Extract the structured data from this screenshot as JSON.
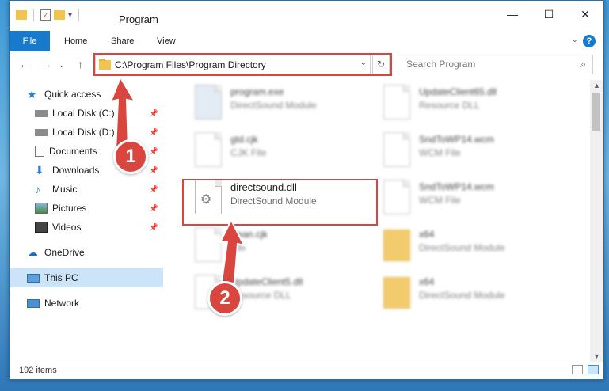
{
  "window": {
    "title": "Program"
  },
  "ribbon": {
    "file": "File",
    "home": "Home",
    "share": "Share",
    "view": "View",
    "help": "?"
  },
  "address": {
    "path": "C:\\Program Files\\Program Directory"
  },
  "search": {
    "placeholder": "Search Program"
  },
  "sidebar": {
    "items": [
      {
        "label": "Quick access",
        "icon": "star-icon"
      },
      {
        "label": "Local Disk (C:)",
        "icon": "drive-icon"
      },
      {
        "label": "Local Disk (D:)",
        "icon": "drive-icon"
      },
      {
        "label": "Documents",
        "icon": "documents-icon"
      },
      {
        "label": "Downloads",
        "icon": "download-icon"
      },
      {
        "label": "Music",
        "icon": "music-icon"
      },
      {
        "label": "Pictures",
        "icon": "pictures-icon"
      },
      {
        "label": "Videos",
        "icon": "videos-icon"
      },
      {
        "label": "OneDrive",
        "icon": "cloud-icon"
      },
      {
        "label": "This PC",
        "icon": "computer-icon"
      },
      {
        "label": "Network",
        "icon": "network-icon"
      }
    ]
  },
  "files": [
    {
      "name": "program.exe",
      "type": "DirectSound Module"
    },
    {
      "name": "UpdateClient65.dll",
      "type": "Resource DLL"
    },
    {
      "name": "gtd.cjk",
      "type": "CJK File"
    },
    {
      "name": "SndToWP14.wcm",
      "type": "WCM File"
    },
    {
      "name": "directsound.dll",
      "type": "DirectSound Module"
    },
    {
      "name": "SndToWP14.wcm",
      "type": "WCM File"
    },
    {
      "name": "clean.cjk",
      "type": "File"
    },
    {
      "name": "x64",
      "type": "DirectSound Module"
    },
    {
      "name": "UpdateClient5.dll",
      "type": "Resource DLL"
    },
    {
      "name": "x64",
      "type": "DirectSound Module"
    }
  ],
  "status": {
    "count": "192 items"
  },
  "callouts": {
    "one": "1",
    "two": "2"
  },
  "colors": {
    "accent": "#1979ca",
    "highlight": "#d9453f"
  }
}
